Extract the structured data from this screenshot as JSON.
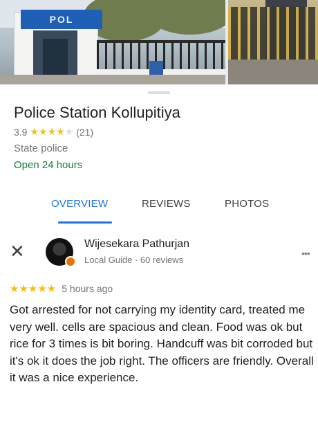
{
  "photos": {
    "main_sign_text": "POL",
    "colors": {
      "sign": "#1f5fb8"
    }
  },
  "place": {
    "title": "Police Station Kollupitiya",
    "rating": "3.9",
    "rating_value": 3.9,
    "stars_full": "★★★★",
    "stars_empty": "★",
    "review_count": "(21)",
    "category": "State police",
    "hours": "Open 24 hours"
  },
  "tabs": [
    {
      "label": "OVERVIEW",
      "active": true
    },
    {
      "label": "REVIEWS",
      "active": false
    },
    {
      "label": "PHOTOS",
      "active": false
    }
  ],
  "review": {
    "close_icon": "close-icon",
    "reviewer_name": "Wijesekara Pathurjan",
    "reviewer_meta": "Local Guide · 60 reviews",
    "more_icon": "more-horizontal-icon",
    "stars": "★★★★★",
    "rating_value": 5,
    "time": "5 hours ago",
    "text": "Got arrested for not carrying my identity card, treated me very well. cells are spacious and clean. Food was ok but rice for 3 times is bit boring. Handcuff was bit corroded but it's ok it does the job right. The officers are friendly. Overall it was a nice experience."
  },
  "colors": {
    "accent": "#1a73e8",
    "star": "#fbbc04",
    "open": "#188038",
    "muted": "#70757a"
  }
}
